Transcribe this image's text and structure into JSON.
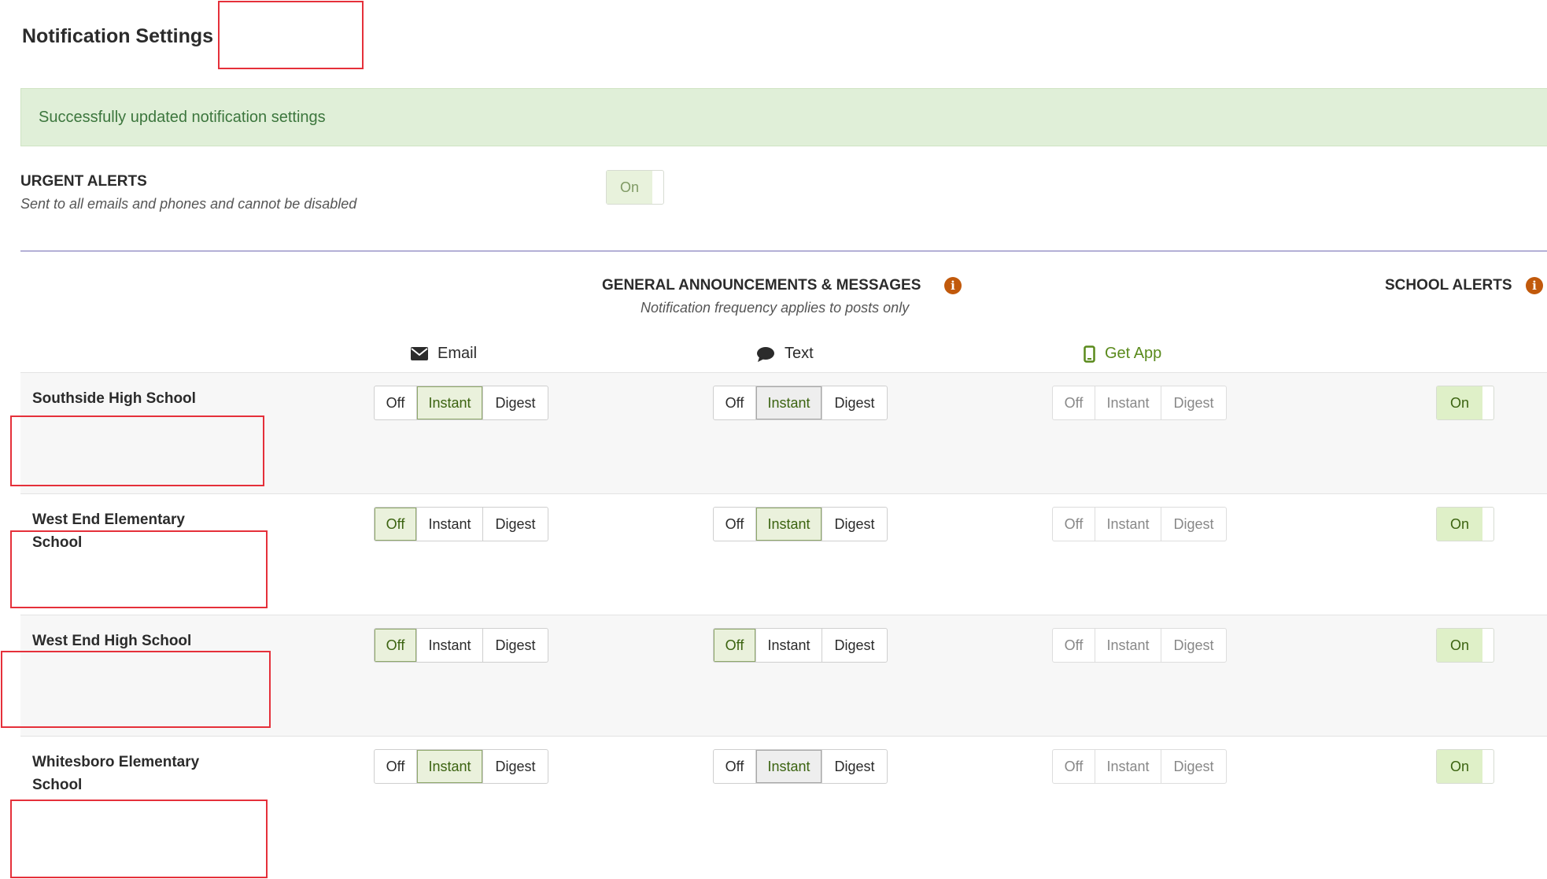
{
  "page": {
    "title": "Notification Settings"
  },
  "alert": {
    "message": "Successfully updated notification settings"
  },
  "urgent": {
    "title": "URGENT ALERTS",
    "subtitle": "Sent to all emails and phones and cannot be disabled",
    "toggle_label": "On"
  },
  "general": {
    "title": "GENERAL ANNOUNCEMENTS & MESSAGES",
    "subtitle": "Notification frequency applies to posts only",
    "info_icon": "i"
  },
  "school_alerts": {
    "title": "SCHOOL ALERTS",
    "info_icon": "i"
  },
  "channels": {
    "email": {
      "label": "Email",
      "icon": "envelope-icon"
    },
    "text": {
      "label": "Text",
      "icon": "chat-bubble-icon"
    },
    "app": {
      "label": "Get App",
      "icon": "phone-icon"
    }
  },
  "options": {
    "off": "Off",
    "instant": "Instant",
    "digest": "Digest",
    "on": "On"
  },
  "schools": [
    {
      "name": "Southside High School",
      "email": "Instant",
      "text": "Instant",
      "app": "none",
      "school_alerts": "On"
    },
    {
      "name": "West End Elementary School",
      "email": "Off",
      "text": "Instant",
      "app": "none",
      "school_alerts": "On"
    },
    {
      "name": "West End High School",
      "email": "Off",
      "text": "Off",
      "app": "none",
      "school_alerts": "On"
    },
    {
      "name": "Whitesboro Elementary School",
      "email": "Instant",
      "text": "Instant",
      "app": "none",
      "school_alerts": "On"
    }
  ],
  "colors": {
    "accent_green": "#3b6310",
    "success_bg": "#e0efd8",
    "success_text": "#3c763d",
    "info_orange": "#c1590b",
    "divider": "#b4b0d6"
  }
}
